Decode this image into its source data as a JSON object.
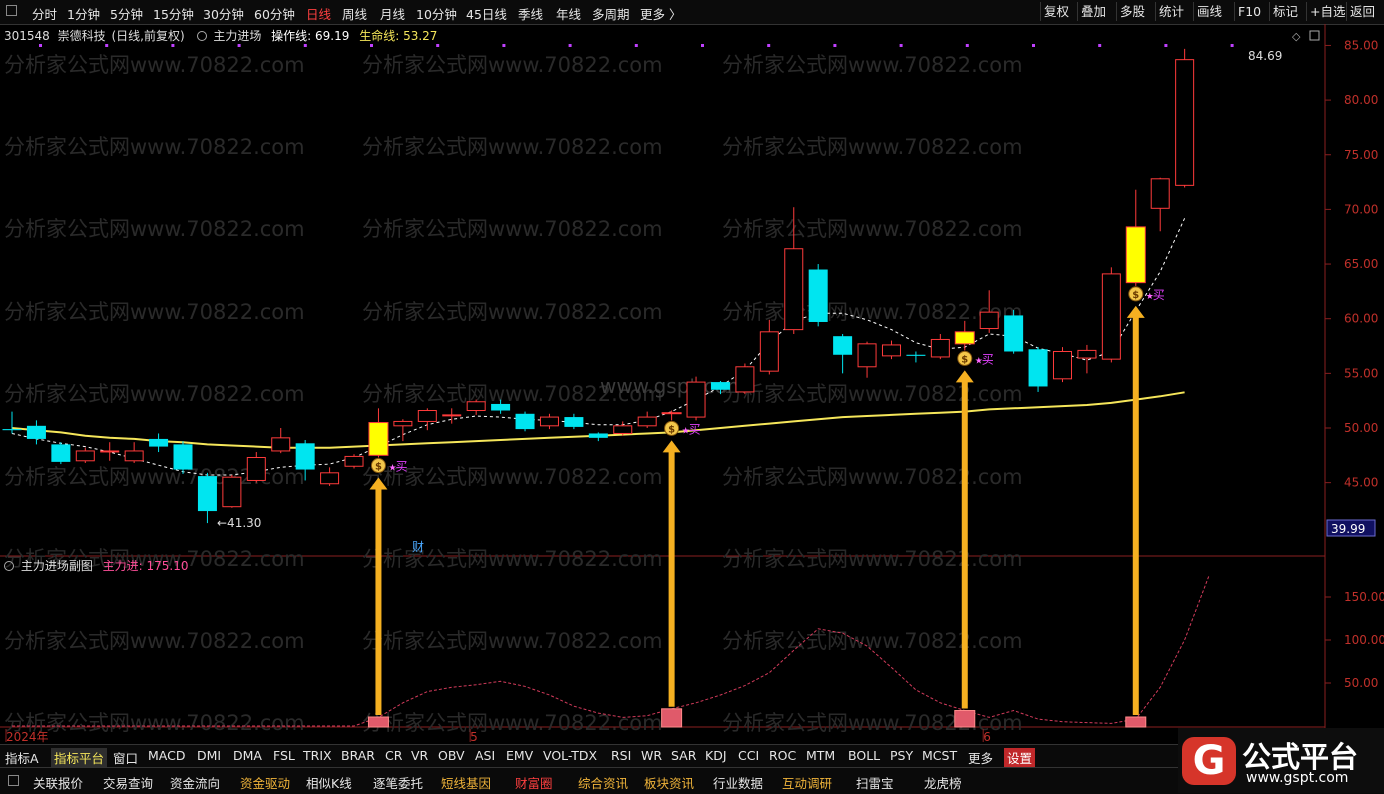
{
  "toolbar": {
    "periods": [
      "分时",
      "1分钟",
      "5分钟",
      "15分钟",
      "30分钟",
      "60分钟",
      "日线",
      "周线",
      "月线",
      "10分钟",
      "45日线",
      "季线",
      "年线",
      "多周期",
      "更多 〉"
    ],
    "active_period": "日线",
    "right_buttons": [
      "复权",
      "叠加",
      "多股",
      "统计",
      "画线",
      "F10",
      "标记",
      "+自选",
      "返回"
    ]
  },
  "stock": {
    "code": "301548",
    "name": "崇德科技",
    "mode": "(日线,前复权)",
    "indicator": "主力进场",
    "op_line_label": "操作线: 69.19",
    "life_line_label": "生命线: 53.27"
  },
  "sub": {
    "name": "主力进场副图",
    "value_label": "主力进: 175.10"
  },
  "watermarks": {
    "site": "分析家公式网www.70822.com",
    "center": "www.gspt.com"
  },
  "colors": {
    "up": "#ff3b3b",
    "down": "#00e5f0",
    "life": "#f5e65a",
    "op": "#ffffff",
    "sub": "#d23b5b",
    "arrow": "#f5b021",
    "grid": "#2a0000",
    "axis": "#8a1f1f",
    "buy": "#e040fb"
  },
  "chart_data": {
    "type": "candlestick",
    "y_axis": {
      "ticks": [
        45,
        50,
        55,
        60,
        65,
        70,
        75,
        80,
        85
      ]
    },
    "sub_axis": {
      "ticks": [
        50,
        100,
        150
      ]
    },
    "current_price_label": "39.99",
    "annotations": {
      "low": "←41.30",
      "high": "84.69",
      "cai": "财",
      "buy": "买"
    },
    "x_labels": [
      {
        "i": 0,
        "text": "2024年"
      },
      {
        "i": 19,
        "text": "5"
      },
      {
        "i": 40,
        "text": "6"
      }
    ],
    "candles": [
      {
        "o": 49.9,
        "c": 49.8,
        "h": 51.5,
        "l": 49.5
      },
      {
        "o": 50.2,
        "c": 49.0,
        "h": 50.7,
        "l": 48.5
      },
      {
        "o": 48.5,
        "c": 46.9,
        "h": 48.7,
        "l": 46.7
      },
      {
        "o": 47.0,
        "c": 47.9,
        "h": 48.2,
        "l": 46.8
      },
      {
        "o": 47.9,
        "c": 47.9,
        "h": 48.7,
        "l": 47.0
      },
      {
        "o": 47.0,
        "c": 47.9,
        "h": 48.7,
        "l": 46.8
      },
      {
        "o": 49.0,
        "c": 48.3,
        "h": 49.5,
        "l": 47.8
      },
      {
        "o": 48.5,
        "c": 46.2,
        "h": 48.8,
        "l": 45.8
      },
      {
        "o": 45.6,
        "c": 42.4,
        "h": 45.9,
        "l": 41.3
      },
      {
        "o": 42.8,
        "c": 45.5,
        "h": 45.7,
        "l": 42.7
      },
      {
        "o": 45.2,
        "c": 47.3,
        "h": 47.8,
        "l": 45.0
      },
      {
        "o": 47.9,
        "c": 49.1,
        "h": 50.0,
        "l": 47.7
      },
      {
        "o": 48.6,
        "c": 46.2,
        "h": 48.9,
        "l": 45.2
      },
      {
        "o": 44.9,
        "c": 45.9,
        "h": 46.4,
        "l": 44.7
      },
      {
        "o": 46.5,
        "c": 47.4,
        "h": 47.6,
        "l": 46.3
      },
      {
        "o": 47.5,
        "c": 50.5,
        "h": 51.8,
        "l": 47.3
      },
      {
        "o": 50.2,
        "c": 50.6,
        "h": 50.8,
        "l": 48.8
      },
      {
        "o": 50.6,
        "c": 51.6,
        "h": 51.8,
        "l": 49.8
      },
      {
        "o": 51.2,
        "c": 51.2,
        "h": 51.8,
        "l": 50.4
      },
      {
        "o": 51.6,
        "c": 52.4,
        "h": 52.6,
        "l": 51.2
      },
      {
        "o": 52.2,
        "c": 51.6,
        "h": 52.6,
        "l": 51.3
      },
      {
        "o": 51.3,
        "c": 49.9,
        "h": 51.5,
        "l": 49.7
      },
      {
        "o": 50.2,
        "c": 51.0,
        "h": 51.3,
        "l": 49.9
      },
      {
        "o": 51.0,
        "c": 50.1,
        "h": 51.3,
        "l": 49.9
      },
      {
        "o": 49.5,
        "c": 49.1,
        "h": 49.6,
        "l": 48.8
      },
      {
        "o": 49.5,
        "c": 50.2,
        "h": 50.6,
        "l": 49.3
      },
      {
        "o": 50.2,
        "c": 51.0,
        "h": 51.5,
        "l": 50.0
      },
      {
        "o": 51.4,
        "c": 51.4,
        "h": 51.6,
        "l": 50.7
      },
      {
        "o": 51.0,
        "c": 54.2,
        "h": 54.7,
        "l": 50.7
      },
      {
        "o": 54.2,
        "c": 53.5,
        "h": 54.3,
        "l": 53.1
      },
      {
        "o": 53.3,
        "c": 55.6,
        "h": 55.9,
        "l": 53.1
      },
      {
        "o": 55.2,
        "c": 58.8,
        "h": 59.9,
        "l": 54.9
      },
      {
        "o": 59.0,
        "c": 66.4,
        "h": 70.2,
        "l": 58.6
      },
      {
        "o": 64.5,
        "c": 59.7,
        "h": 65.0,
        "l": 59.3
      },
      {
        "o": 58.4,
        "c": 56.7,
        "h": 58.6,
        "l": 55.0
      },
      {
        "o": 55.6,
        "c": 57.7,
        "h": 57.9,
        "l": 54.6
      },
      {
        "o": 56.6,
        "c": 57.6,
        "h": 58.0,
        "l": 56.3
      },
      {
        "o": 56.7,
        "c": 56.6,
        "h": 57.0,
        "l": 56.0
      },
      {
        "o": 56.5,
        "c": 58.1,
        "h": 58.6,
        "l": 56.3
      },
      {
        "o": 57.7,
        "c": 58.8,
        "h": 59.8,
        "l": 57.1
      },
      {
        "o": 59.1,
        "c": 60.6,
        "h": 62.6,
        "l": 58.7
      },
      {
        "o": 60.3,
        "c": 57.0,
        "h": 60.8,
        "l": 56.8
      },
      {
        "o": 57.2,
        "c": 53.8,
        "h": 57.4,
        "l": 53.3
      },
      {
        "o": 54.5,
        "c": 57.0,
        "h": 57.4,
        "l": 54.2
      },
      {
        "o": 56.4,
        "c": 57.1,
        "h": 57.6,
        "l": 55.0
      },
      {
        "o": 56.3,
        "c": 64.1,
        "h": 64.7,
        "l": 56.0
      },
      {
        "o": 63.3,
        "c": 68.4,
        "h": 71.8,
        "l": 63.0
      },
      {
        "o": 70.1,
        "c": 72.8,
        "h": 72.9,
        "l": 68.0
      },
      {
        "o": 72.2,
        "c": 83.7,
        "h": 84.69,
        "l": 72.0
      }
    ],
    "series": [
      {
        "name": "生命线",
        "values": [
          50,
          49.8,
          49.6,
          49.3,
          49.1,
          49,
          48.8,
          48.7,
          48.5,
          48.4,
          48.3,
          48.2,
          48.2,
          48.2,
          48.3,
          48.4,
          48.5,
          48.6,
          48.7,
          48.8,
          48.9,
          49,
          49.1,
          49.2,
          49.3,
          49.4,
          49.5,
          49.6,
          49.8,
          50.0,
          50.2,
          50.4,
          50.6,
          50.8,
          51.0,
          51.1,
          51.2,
          51.3,
          51.4,
          51.5,
          51.7,
          51.8,
          51.9,
          52.0,
          52.1,
          52.3,
          52.6,
          52.9,
          53.27
        ]
      },
      {
        "name": "操作线",
        "values": [
          49.5,
          49.0,
          48.6,
          48.3,
          47.8,
          47.2,
          46.6,
          46.0,
          45.7,
          45.7,
          46.0,
          46.4,
          46.6,
          46.7,
          47.3,
          48.3,
          49.4,
          50.3,
          50.8,
          51.1,
          51.0,
          50.8,
          50.7,
          50.5,
          50.3,
          50.3,
          50.7,
          51.5,
          52.6,
          53.8,
          55.3,
          57.8,
          59.8,
          60.5,
          60.5,
          59.9,
          59.0,
          57.8,
          57.2,
          57.4,
          58.6,
          58.4,
          57.3,
          56.8,
          56.2,
          57.0,
          60.7,
          64.3,
          69.19
        ]
      },
      {
        "name": "主力进",
        "values": [
          0,
          0,
          0,
          0,
          0,
          0,
          0,
          0,
          0,
          0,
          0,
          0,
          0,
          0,
          0,
          10,
          27,
          40,
          45,
          48,
          52,
          46,
          36,
          23,
          15,
          10,
          12,
          20,
          27,
          36,
          47,
          62,
          88,
          113,
          108,
          93,
          68,
          42,
          27,
          18,
          10,
          18,
          8,
          5,
          4,
          3,
          8,
          45,
          100,
          175.1
        ]
      }
    ],
    "buy_signals": [
      15,
      27,
      39,
      46
    ]
  }
}
